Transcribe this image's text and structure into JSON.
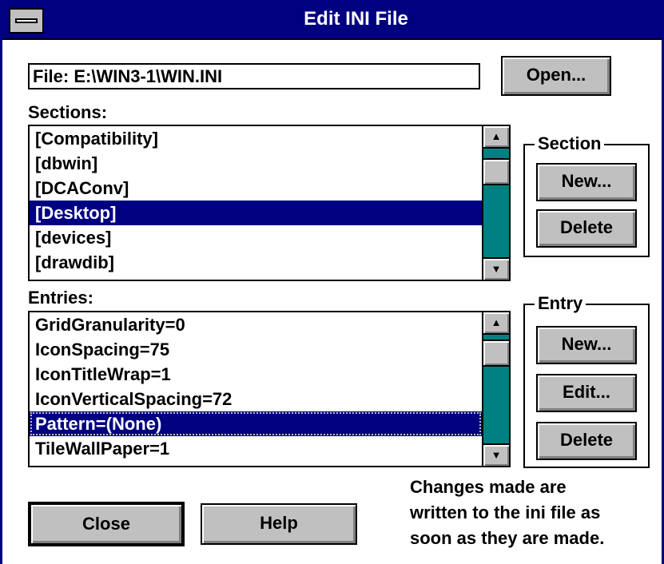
{
  "window": {
    "title": "Edit INI File"
  },
  "file": {
    "label": "File: E:\\WIN3-1\\WIN.INI",
    "open_label": "Open..."
  },
  "sections": {
    "label": "Sections:",
    "items": [
      "[Compatibility]",
      "[dbwin]",
      "[DCAConv]",
      "[Desktop]",
      "[devices]",
      "[drawdib]"
    ],
    "selected": "[Desktop]"
  },
  "section_group": {
    "title": "Section",
    "new_label": "New...",
    "delete_label": "Delete"
  },
  "entries": {
    "label": "Entries:",
    "items": [
      "GridGranularity=0",
      "IconSpacing=75",
      "IconTitleWrap=1",
      "IconVerticalSpacing=72",
      "Pattern=(None)",
      "TileWallPaper=1"
    ],
    "selected": "Pattern=(None)"
  },
  "entry_group": {
    "title": "Entry",
    "new_label": "New...",
    "edit_label": "Edit...",
    "delete_label": "Delete"
  },
  "footer": {
    "close_label": "Close",
    "help_label": "Help",
    "note_lines": [
      "Changes made are",
      "written to the ini file as",
      "soon as they are made."
    ]
  },
  "colors": {
    "title_bar": "#000080",
    "selection": "#000080",
    "scrollbar_track": "#008080",
    "button_face": "#c0c0c0"
  },
  "icons": {
    "system_menu": "system-menu-icon",
    "scroll_up": "up-arrow-icon",
    "scroll_down": "down-arrow-icon"
  }
}
